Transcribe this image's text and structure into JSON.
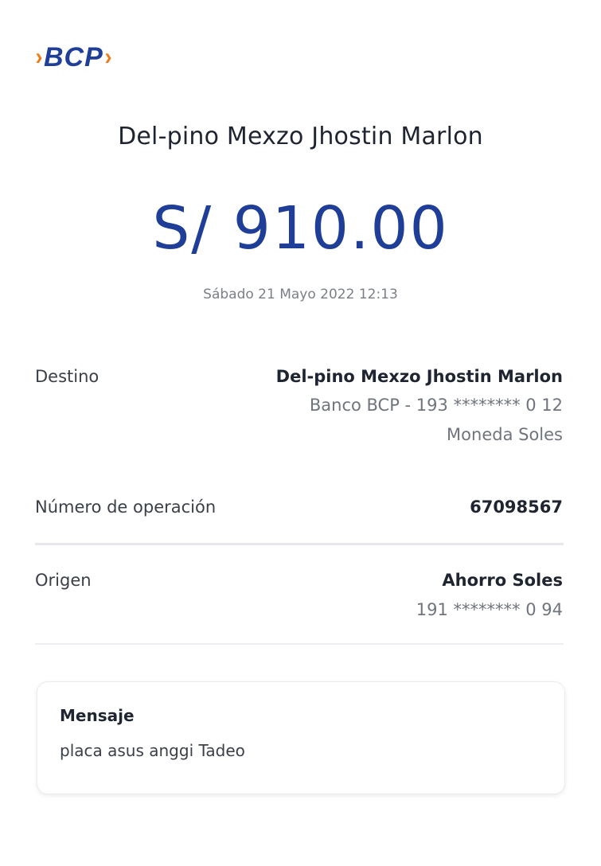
{
  "brand": {
    "logo_text": "BCP",
    "colors": {
      "primary": "#1f3e98",
      "accent": "#f07b16"
    }
  },
  "header": {
    "recipient_name": "Del-pino Mexzo Jhostin Marlon",
    "amount": "S/ 910.00",
    "datetime": "Sábado 21 Mayo 2022 12:13"
  },
  "details": {
    "destino": {
      "label": "Destino",
      "name": "Del-pino Mexzo Jhostin Marlon",
      "account": "Banco BCP - 193 ******** 0 12",
      "currency": "Moneda Soles"
    },
    "operacion": {
      "label": "Número de operación",
      "value": "67098567"
    },
    "origen": {
      "label": "Origen",
      "account_type": "Ahorro Soles",
      "account": "191 ******** 0 94"
    }
  },
  "message": {
    "title": "Mensaje",
    "body": "placa asus anggi Tadeo"
  }
}
